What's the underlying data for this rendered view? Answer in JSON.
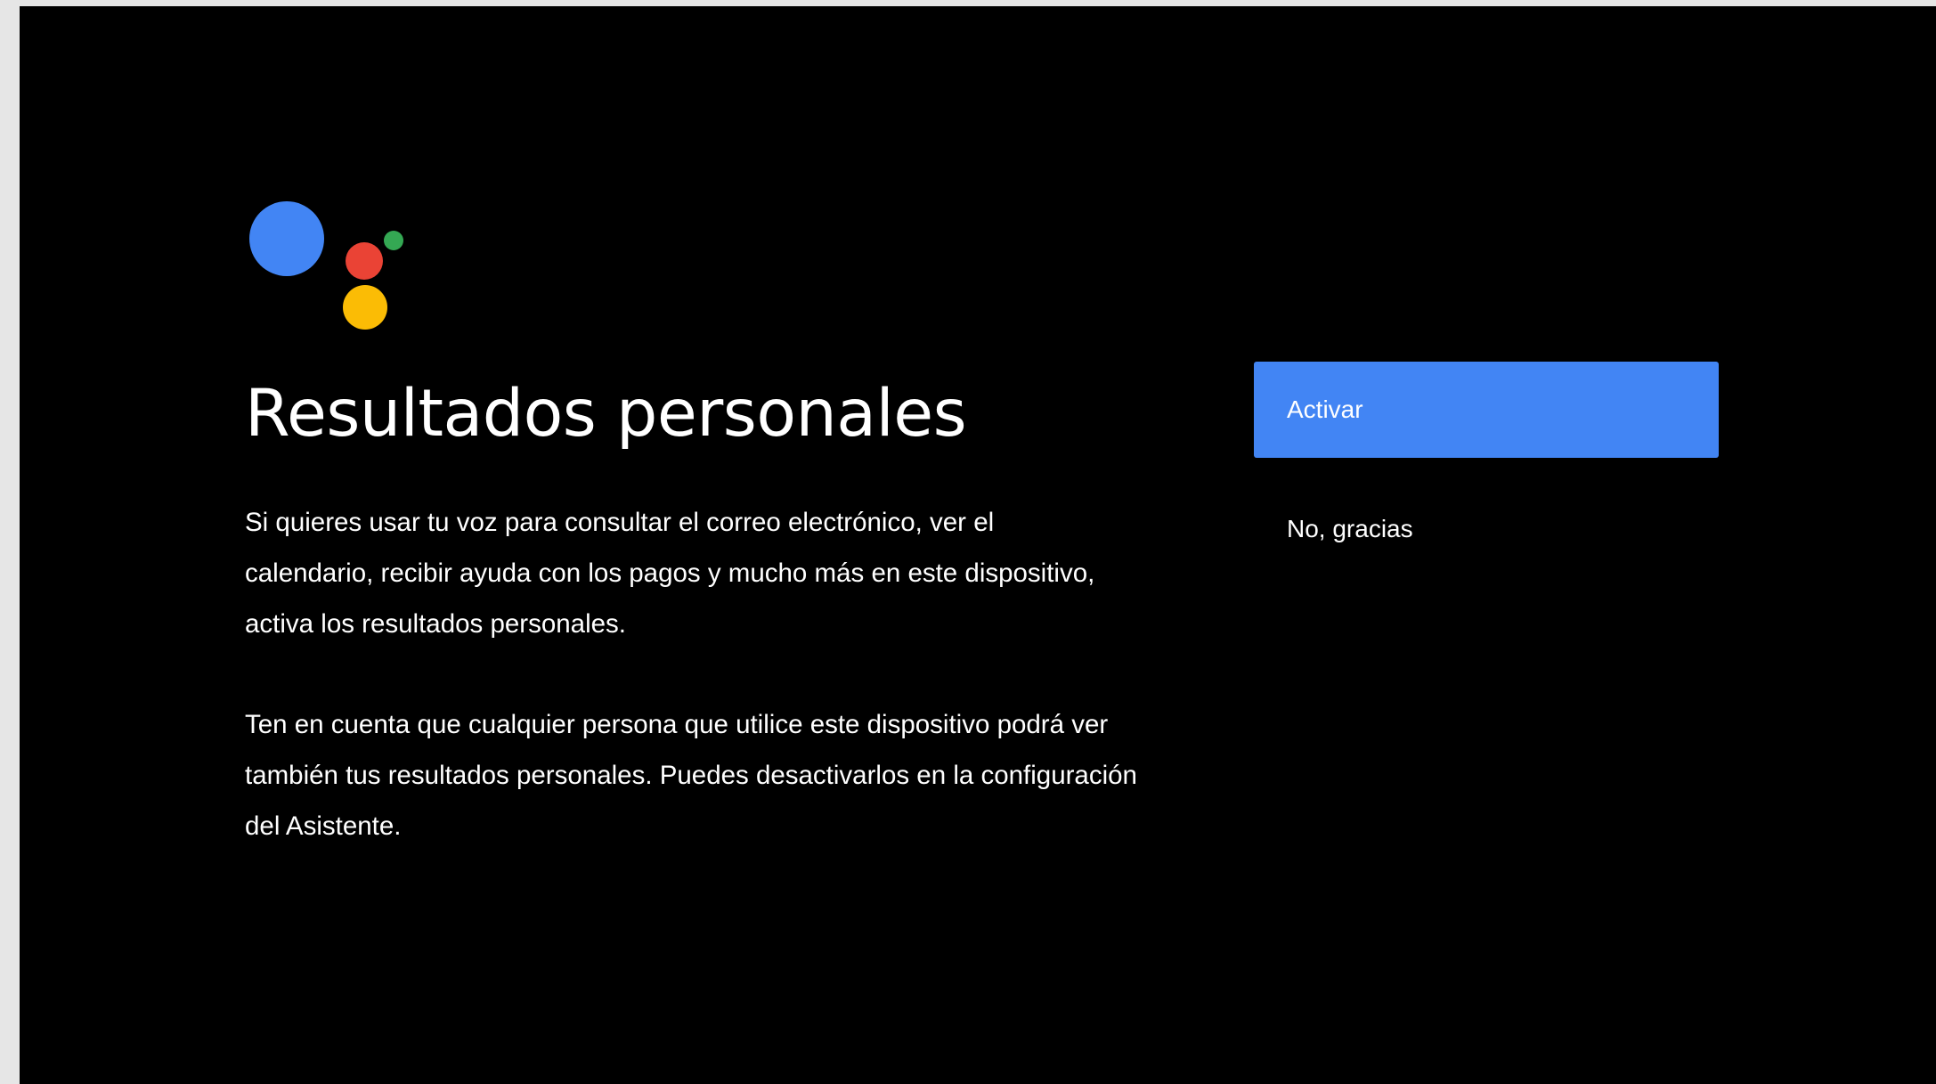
{
  "logo": {
    "icon": "google-assistant-icon",
    "colors": {
      "blue": "#4285F4",
      "red": "#EA4335",
      "green": "#34A853",
      "yellow": "#FBBC05"
    }
  },
  "main": {
    "title": "Resultados personales",
    "paragraph_1": "Si quieres usar tu voz para consultar el correo electrónico, ver el calendario, recibir ayuda con los pagos y mucho más en este dispositivo, activa los resultados personales.",
    "paragraph_2": "Ten en cuenta que cualquier persona que utilice este dispositivo podrá ver también tus resultados personales. Puedes desactivarlos en la configuración del Asistente."
  },
  "actions": {
    "activate_label": "Activar",
    "decline_label": "No, gracias",
    "accent_color": "#4285F4"
  }
}
